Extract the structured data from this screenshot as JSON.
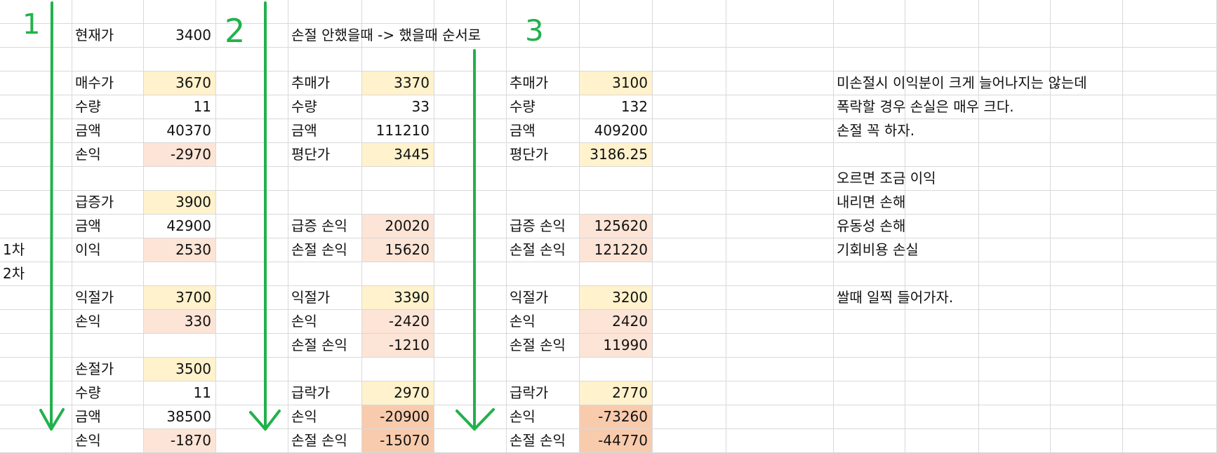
{
  "sheet": {
    "col_a": {
      "r10": "1차",
      "r11": "2차"
    },
    "block1": {
      "r1": {
        "label": "현재가",
        "value": "3400"
      },
      "r3": {
        "label": "매수가",
        "value": "3670"
      },
      "r4": {
        "label": "수량",
        "value": "11"
      },
      "r5": {
        "label": "금액",
        "value": "40370"
      },
      "r6": {
        "label": "손익",
        "value": "-2970"
      },
      "r8": {
        "label": "급증가",
        "value": "3900"
      },
      "r9": {
        "label": "금액",
        "value": "42900"
      },
      "r10": {
        "label": "이익",
        "value": "2530"
      },
      "r12": {
        "label": "익절가",
        "value": "3700"
      },
      "r13": {
        "label": "손익",
        "value": "330"
      },
      "r15": {
        "label": "손절가",
        "value": "3500"
      },
      "r16": {
        "label": "수량",
        "value": "11"
      },
      "r17": {
        "label": "금액",
        "value": "38500"
      },
      "r18": {
        "label": "손익",
        "value": "-1870"
      }
    },
    "block2": {
      "r1": {
        "label": "손절 안했을때 -> 했을때 순서로"
      },
      "r3": {
        "label": "추매가",
        "value": "3370"
      },
      "r4": {
        "label": "수량",
        "value": "33"
      },
      "r5": {
        "label": "금액",
        "value": "111210"
      },
      "r6": {
        "label": "평단가",
        "value": "3445"
      },
      "r9": {
        "label": "급증 손익",
        "value": "20020"
      },
      "r10": {
        "label": "손절 손익",
        "value": "15620"
      },
      "r12": {
        "label": "익절가",
        "value": "3390"
      },
      "r13": {
        "label": "손익",
        "value": "-2420"
      },
      "r14": {
        "label": "손절 손익",
        "value": "-1210"
      },
      "r16": {
        "label": "급락가",
        "value": "2970"
      },
      "r17": {
        "label": "손익",
        "value": "-20900"
      },
      "r18": {
        "label": "손절 손익",
        "value": "-15070"
      }
    },
    "block3": {
      "r3": {
        "label": "추매가",
        "value": "3100"
      },
      "r4": {
        "label": "수량",
        "value": "132"
      },
      "r5": {
        "label": "금액",
        "value": "409200"
      },
      "r6": {
        "label": "평단가",
        "value": "3186.25"
      },
      "r9": {
        "label": "급증 손익",
        "value": "125620"
      },
      "r10": {
        "label": "손절 손익",
        "value": "121220"
      },
      "r12": {
        "label": "익절가",
        "value": "3200"
      },
      "r13": {
        "label": "손익",
        "value": "2420"
      },
      "r14": {
        "label": "손절 손익",
        "value": "11990"
      },
      "r16": {
        "label": "급락가",
        "value": "2770"
      },
      "r17": {
        "label": "손익",
        "value": "-73260"
      },
      "r18": {
        "label": "손절 손익",
        "value": "-44770"
      }
    },
    "notes": {
      "r3": "미손절시 이익분이 크게 늘어나지는 않는데",
      "r4": "폭락할 경우 손실은 매우 크다.",
      "r5": "손절 꼭 하자.",
      "r7": "오르면 조금 이익",
      "r8": "내리면 손해",
      "r9": "유동성 손해",
      "r10": "기회비용 손실",
      "r12": "쌀때 일찍 들어가자."
    }
  },
  "annotations": {
    "marks": [
      "1",
      "2",
      "3"
    ],
    "color": "#22b14c"
  },
  "colors": {
    "light_yellow": "#fff2cc",
    "light_peach": "#fce4d6",
    "peach": "#f8cbad",
    "gridline": "#d9d9d9"
  }
}
